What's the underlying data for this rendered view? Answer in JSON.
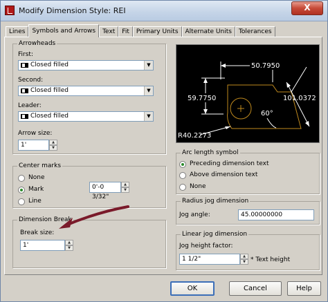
{
  "window": {
    "title": "Modify Dimension Style: REI",
    "close_glyph": "X"
  },
  "tabs": [
    {
      "label": "Lines"
    },
    {
      "label": "Symbols and Arrows",
      "active": true
    },
    {
      "label": "Text"
    },
    {
      "label": "Fit"
    },
    {
      "label": "Primary Units"
    },
    {
      "label": "Alternate Units"
    },
    {
      "label": "Tolerances"
    }
  ],
  "arrowheads": {
    "group_title": "Arrowheads",
    "first_label": "First:",
    "first_value": "Closed filled",
    "second_label": "Second:",
    "second_value": "Closed filled",
    "leader_label": "Leader:",
    "leader_value": "Closed filled",
    "arrow_size_label": "Arrow size:",
    "arrow_size_value": "1'"
  },
  "center_marks": {
    "group_title": "Center marks",
    "options": [
      "None",
      "Mark",
      "Line"
    ],
    "selected": "Mark",
    "size_value": "0'-0 3/32\""
  },
  "dimension_break": {
    "group_title": "Dimension Break",
    "break_size_label": "Break size:",
    "break_size_value": "1'"
  },
  "preview": {
    "dim_top": "50.7950",
    "dim_left": "59.7750",
    "dim_right": "101.0372",
    "dim_angle": "60°",
    "dim_radius": "R40.2273",
    "line_color": "#c08a1e",
    "text_color": "#ffffff"
  },
  "arc_length": {
    "group_title": "Arc length symbol",
    "options": [
      "Preceding dimension text",
      "Above dimension text",
      "None"
    ],
    "selected": "Preceding dimension text"
  },
  "radius_jog": {
    "group_title": "Radius jog dimension",
    "jog_angle_label": "Jog angle:",
    "jog_angle_value": "45.00000000"
  },
  "linear_jog": {
    "group_title": "Linear jog dimension",
    "jog_height_label": "Jog height factor:",
    "jog_height_value": "1 1/2\"",
    "suffix": "* Text height"
  },
  "buttons": {
    "ok": "OK",
    "cancel": "Cancel",
    "help": "Help"
  },
  "annotation": {
    "arrow_color": "#7a1a2a"
  }
}
